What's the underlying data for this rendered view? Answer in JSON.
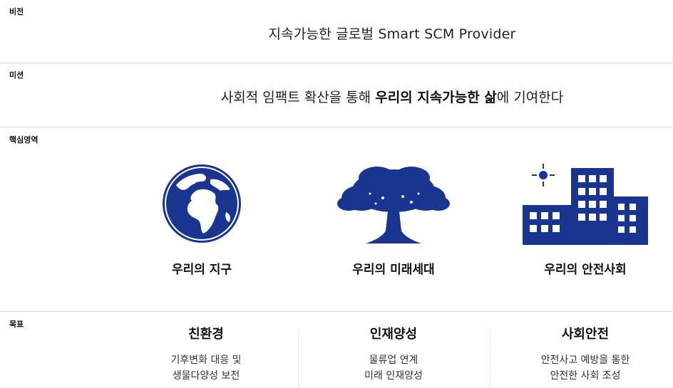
{
  "vision": {
    "label": "비전",
    "text": "지속가능한 글로벌 Smart SCM Provider"
  },
  "mission": {
    "label": "미션",
    "text_before": "사회적 임팩트 확산을 통해 ",
    "text_bold": "우리의 지속가능한 삶",
    "text_after": "에 기여한다"
  },
  "core_areas": {
    "label": "핵심영역",
    "items": [
      {
        "icon": "globe-icon",
        "label": "우리의 지구"
      },
      {
        "icon": "tree-icon",
        "label": "우리의 미래세대"
      },
      {
        "icon": "buildings-icon",
        "label": "우리의 안전사회"
      }
    ]
  },
  "goals": {
    "label": "목표",
    "items": [
      {
        "title": "친환경",
        "lines": [
          "기후변화 대응 및",
          "생물다양성 보전"
        ]
      },
      {
        "title": "인재양성",
        "lines": [
          "물류업 연계",
          "미래 인재양성"
        ]
      },
      {
        "title": "사회안전",
        "lines": [
          "안전사고 예방을 통한",
          "안전한 사회 조성"
        ]
      }
    ]
  },
  "colors": {
    "accent": "#1a3590",
    "divider": "#d9d9d9"
  }
}
